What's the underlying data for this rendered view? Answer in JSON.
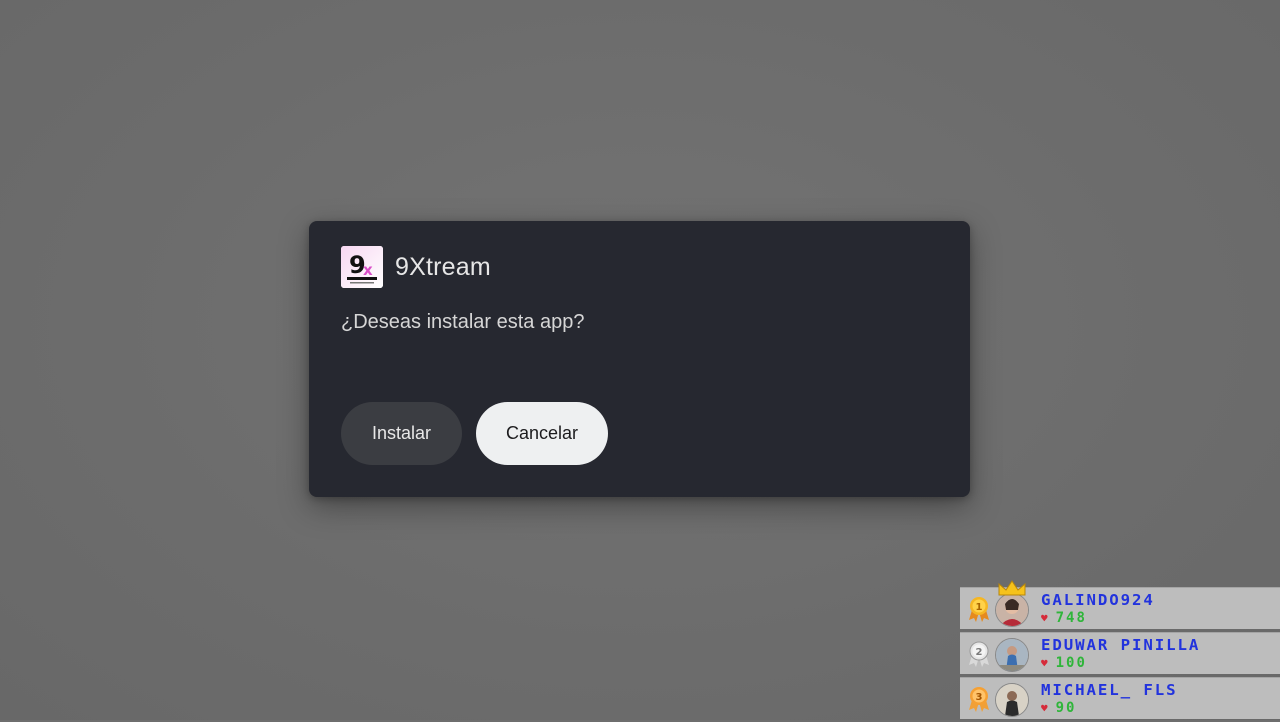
{
  "dialog": {
    "app_name": "9Xtream",
    "app_icon": "9x-iptv-app-icon",
    "prompt": "¿Deseas instalar esta app?",
    "install_label": "Instalar",
    "cancel_label": "Cancelar",
    "colors": {
      "dialog_bg": "#262830",
      "install_bg": "#3b3d42",
      "cancel_bg": "#eef0f1"
    }
  },
  "leaderboard": {
    "entries": [
      {
        "rank": "1",
        "name": "GALINDO924",
        "score": "748",
        "medal": "gold-medal-icon",
        "crown": true
      },
      {
        "rank": "2",
        "name": "EDUWAR PINILLA",
        "score": "100",
        "medal": "silver-medal-icon",
        "crown": false
      },
      {
        "rank": "3",
        "name": "MICHAEL_ FLS",
        "score": "90",
        "medal": "bronze-medal-icon",
        "crown": false
      }
    ],
    "colors": {
      "name": "#2233dd",
      "score": "#2fb53a",
      "heart": "#d62b3a"
    }
  }
}
